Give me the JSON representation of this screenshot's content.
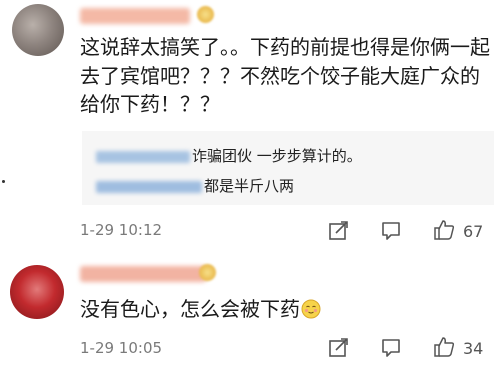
{
  "comments": [
    {
      "text": "这说辞太搞笑了。。下药的前提也得是你俩一起去了宾馆吧？？？不然吃个饺子能大庭广众的给你下药！？？",
      "replies": [
        {
          "text": "诈骗团伙 一步步算计的。"
        },
        {
          "text": "都是半斤八两"
        }
      ],
      "time": "1-29 10:12",
      "likes": "67"
    },
    {
      "text": "没有色心，怎么会被下药",
      "emoji": "blush-smile-emoji",
      "time": "1-29 10:05",
      "likes": "34"
    }
  ],
  "colors": {
    "text": "#1a1a1a",
    "meta": "#7a7a7a",
    "reply_bg": "#f6f6f6",
    "icon": "#555555"
  },
  "icons": [
    "share-icon",
    "comment-icon",
    "thumbs-up-icon"
  ]
}
